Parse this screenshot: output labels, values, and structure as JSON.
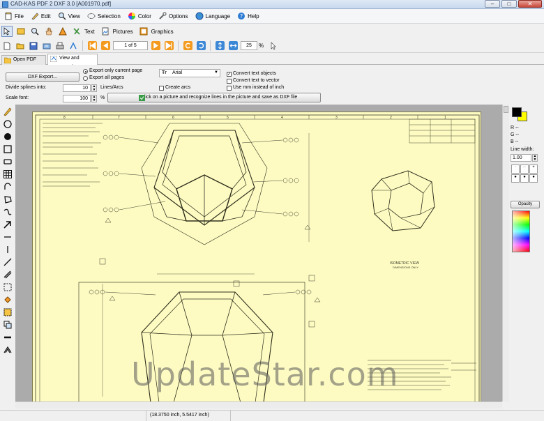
{
  "window": {
    "title": "CAD-KAS PDF 2 DXF 3.0   [A001970.pdf]",
    "minimize": "–",
    "maximize": "□",
    "close": "✕"
  },
  "menu": [
    {
      "label": "File",
      "icon": "file-icon"
    },
    {
      "label": "Edit",
      "icon": "edit-icon"
    },
    {
      "label": "View",
      "icon": "view-icon"
    },
    {
      "label": "Selection",
      "icon": "selection-icon"
    },
    {
      "label": "Color",
      "icon": "color-wheel-icon"
    },
    {
      "label": "Options",
      "icon": "options-icon"
    },
    {
      "label": "Language",
      "icon": "globe-icon"
    },
    {
      "label": "Help",
      "icon": "help-icon"
    }
  ],
  "toolbar1": {
    "text_label": "Text",
    "pictures_label": "Pictures",
    "graphics_label": "Graphics"
  },
  "toolbar2": {
    "page_indicator": "1 of 5",
    "zoom_value": "25",
    "zoom_unit": "%"
  },
  "tabs": [
    {
      "label": "Open PDF file"
    },
    {
      "label": "View and export"
    }
  ],
  "export_panel": {
    "dxf_export_button": "DXF Export...",
    "export_current_page": "Export only current page",
    "export_all_pages": "Export all pages",
    "font_value": "Arial",
    "convert_text_objects": "Convert text objects",
    "convert_text_to_vector": "Convert text to vector",
    "use_mm_instead_of_inch": "Use mm instead of inch",
    "divide_splines_label": "Divide splines into:",
    "divide_splines_value": "10",
    "divide_splines_unit": "Lines/Arcs",
    "create_arcs": "Create arcs",
    "scale_font_label": "Scale font:",
    "scale_font_value": "100",
    "scale_font_unit": "%",
    "recognize_button": "Click on a picture and recognize lines in the picture and save as DXF file"
  },
  "drawing": {
    "view_label": "ISOMETRIC VIEW",
    "view_sublabel": "DIMENSIONS ONLY",
    "col_labels": [
      "8",
      "7",
      "6",
      "5",
      "4",
      "3",
      "2",
      "1"
    ]
  },
  "right_panel": {
    "r_label": "R --",
    "g_label": "G --",
    "b_label": "B --",
    "line_width_label": "Line width:",
    "line_width_value": "1.00",
    "opacity_button": "Opacity",
    "primary_color": "#000000",
    "secondary_color": "#ffff00"
  },
  "status": {
    "coordinates": "(18.3750 inch, 5.5417 inch)"
  },
  "watermark": "UpdateStar.com"
}
